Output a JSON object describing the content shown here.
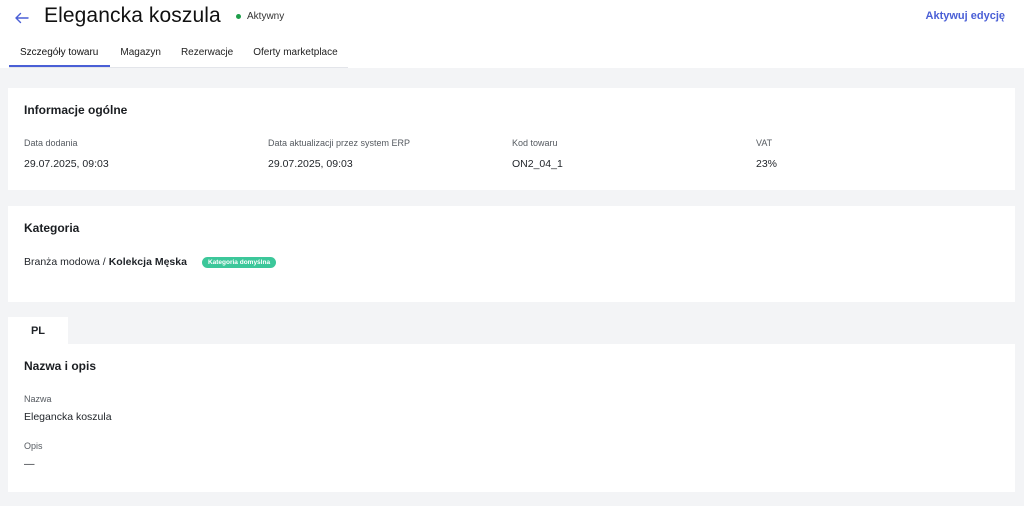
{
  "header": {
    "title": "Elegancka koszula",
    "status": "Aktywny",
    "status_color": "#1e9e4a",
    "edit_label": "Aktywuj edycję",
    "accent_color": "#4a5fd6",
    "back_icon": "arrow-left-icon"
  },
  "tabs": [
    {
      "label": "Szczegóły towaru",
      "active": true
    },
    {
      "label": "Magazyn",
      "active": false
    },
    {
      "label": "Rezerwacje",
      "active": false
    },
    {
      "label": "Oferty marketplace",
      "active": false
    }
  ],
  "general": {
    "title": "Informacje ogólne",
    "fields": [
      {
        "label": "Data dodania",
        "value": "29.07.2025, 09:03"
      },
      {
        "label": "Data aktualizacji przez system ERP",
        "value": "29.07.2025, 09:03"
      },
      {
        "label": "Kod towaru",
        "value": "ON2_04_1"
      },
      {
        "label": "VAT",
        "value": "23%"
      }
    ]
  },
  "category": {
    "title": "Kategoria",
    "path_prefix": "Branża modowa /",
    "path_leaf": "Kolekcja Męska",
    "badge": "Kategoria domyślna",
    "badge_color": "#3cc79a"
  },
  "lang_tab": "PL",
  "name_desc": {
    "title": "Nazwa i opis",
    "name_label": "Nazwa",
    "name_value": "Elegancka koszula",
    "desc_label": "Opis",
    "desc_value": "—"
  }
}
